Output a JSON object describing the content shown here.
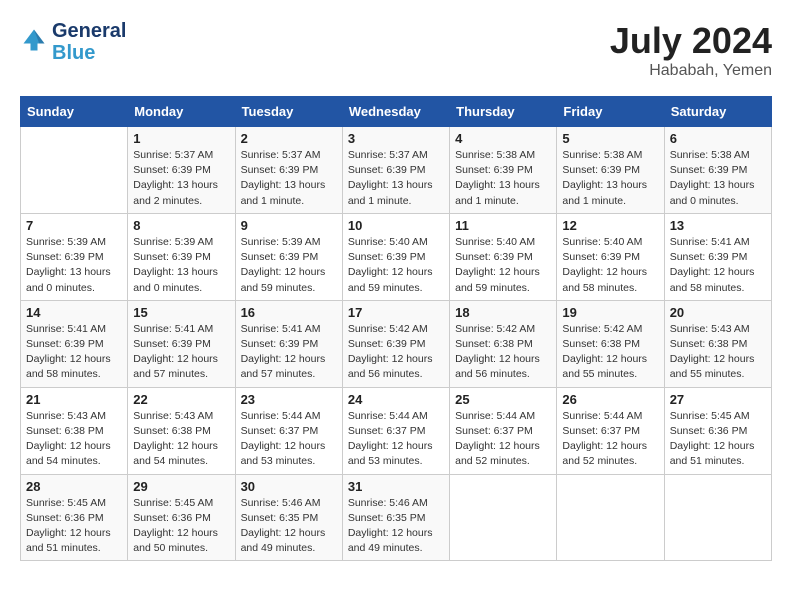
{
  "header": {
    "logo_line1": "General",
    "logo_line2": "Blue",
    "month": "July 2024",
    "location": "Hababah, Yemen"
  },
  "weekdays": [
    "Sunday",
    "Monday",
    "Tuesday",
    "Wednesday",
    "Thursday",
    "Friday",
    "Saturday"
  ],
  "weeks": [
    [
      {
        "day": "",
        "info": ""
      },
      {
        "day": "1",
        "info": "Sunrise: 5:37 AM\nSunset: 6:39 PM\nDaylight: 13 hours\nand 2 minutes."
      },
      {
        "day": "2",
        "info": "Sunrise: 5:37 AM\nSunset: 6:39 PM\nDaylight: 13 hours\nand 1 minute."
      },
      {
        "day": "3",
        "info": "Sunrise: 5:37 AM\nSunset: 6:39 PM\nDaylight: 13 hours\nand 1 minute."
      },
      {
        "day": "4",
        "info": "Sunrise: 5:38 AM\nSunset: 6:39 PM\nDaylight: 13 hours\nand 1 minute."
      },
      {
        "day": "5",
        "info": "Sunrise: 5:38 AM\nSunset: 6:39 PM\nDaylight: 13 hours\nand 1 minute."
      },
      {
        "day": "6",
        "info": "Sunrise: 5:38 AM\nSunset: 6:39 PM\nDaylight: 13 hours\nand 0 minutes."
      }
    ],
    [
      {
        "day": "7",
        "info": "Sunrise: 5:39 AM\nSunset: 6:39 PM\nDaylight: 13 hours\nand 0 minutes."
      },
      {
        "day": "8",
        "info": "Sunrise: 5:39 AM\nSunset: 6:39 PM\nDaylight: 13 hours\nand 0 minutes."
      },
      {
        "day": "9",
        "info": "Sunrise: 5:39 AM\nSunset: 6:39 PM\nDaylight: 12 hours\nand 59 minutes."
      },
      {
        "day": "10",
        "info": "Sunrise: 5:40 AM\nSunset: 6:39 PM\nDaylight: 12 hours\nand 59 minutes."
      },
      {
        "day": "11",
        "info": "Sunrise: 5:40 AM\nSunset: 6:39 PM\nDaylight: 12 hours\nand 59 minutes."
      },
      {
        "day": "12",
        "info": "Sunrise: 5:40 AM\nSunset: 6:39 PM\nDaylight: 12 hours\nand 58 minutes."
      },
      {
        "day": "13",
        "info": "Sunrise: 5:41 AM\nSunset: 6:39 PM\nDaylight: 12 hours\nand 58 minutes."
      }
    ],
    [
      {
        "day": "14",
        "info": "Sunrise: 5:41 AM\nSunset: 6:39 PM\nDaylight: 12 hours\nand 58 minutes."
      },
      {
        "day": "15",
        "info": "Sunrise: 5:41 AM\nSunset: 6:39 PM\nDaylight: 12 hours\nand 57 minutes."
      },
      {
        "day": "16",
        "info": "Sunrise: 5:41 AM\nSunset: 6:39 PM\nDaylight: 12 hours\nand 57 minutes."
      },
      {
        "day": "17",
        "info": "Sunrise: 5:42 AM\nSunset: 6:39 PM\nDaylight: 12 hours\nand 56 minutes."
      },
      {
        "day": "18",
        "info": "Sunrise: 5:42 AM\nSunset: 6:38 PM\nDaylight: 12 hours\nand 56 minutes."
      },
      {
        "day": "19",
        "info": "Sunrise: 5:42 AM\nSunset: 6:38 PM\nDaylight: 12 hours\nand 55 minutes."
      },
      {
        "day": "20",
        "info": "Sunrise: 5:43 AM\nSunset: 6:38 PM\nDaylight: 12 hours\nand 55 minutes."
      }
    ],
    [
      {
        "day": "21",
        "info": "Sunrise: 5:43 AM\nSunset: 6:38 PM\nDaylight: 12 hours\nand 54 minutes."
      },
      {
        "day": "22",
        "info": "Sunrise: 5:43 AM\nSunset: 6:38 PM\nDaylight: 12 hours\nand 54 minutes."
      },
      {
        "day": "23",
        "info": "Sunrise: 5:44 AM\nSunset: 6:37 PM\nDaylight: 12 hours\nand 53 minutes."
      },
      {
        "day": "24",
        "info": "Sunrise: 5:44 AM\nSunset: 6:37 PM\nDaylight: 12 hours\nand 53 minutes."
      },
      {
        "day": "25",
        "info": "Sunrise: 5:44 AM\nSunset: 6:37 PM\nDaylight: 12 hours\nand 52 minutes."
      },
      {
        "day": "26",
        "info": "Sunrise: 5:44 AM\nSunset: 6:37 PM\nDaylight: 12 hours\nand 52 minutes."
      },
      {
        "day": "27",
        "info": "Sunrise: 5:45 AM\nSunset: 6:36 PM\nDaylight: 12 hours\nand 51 minutes."
      }
    ],
    [
      {
        "day": "28",
        "info": "Sunrise: 5:45 AM\nSunset: 6:36 PM\nDaylight: 12 hours\nand 51 minutes."
      },
      {
        "day": "29",
        "info": "Sunrise: 5:45 AM\nSunset: 6:36 PM\nDaylight: 12 hours\nand 50 minutes."
      },
      {
        "day": "30",
        "info": "Sunrise: 5:46 AM\nSunset: 6:35 PM\nDaylight: 12 hours\nand 49 minutes."
      },
      {
        "day": "31",
        "info": "Sunrise: 5:46 AM\nSunset: 6:35 PM\nDaylight: 12 hours\nand 49 minutes."
      },
      {
        "day": "",
        "info": ""
      },
      {
        "day": "",
        "info": ""
      },
      {
        "day": "",
        "info": ""
      }
    ]
  ]
}
